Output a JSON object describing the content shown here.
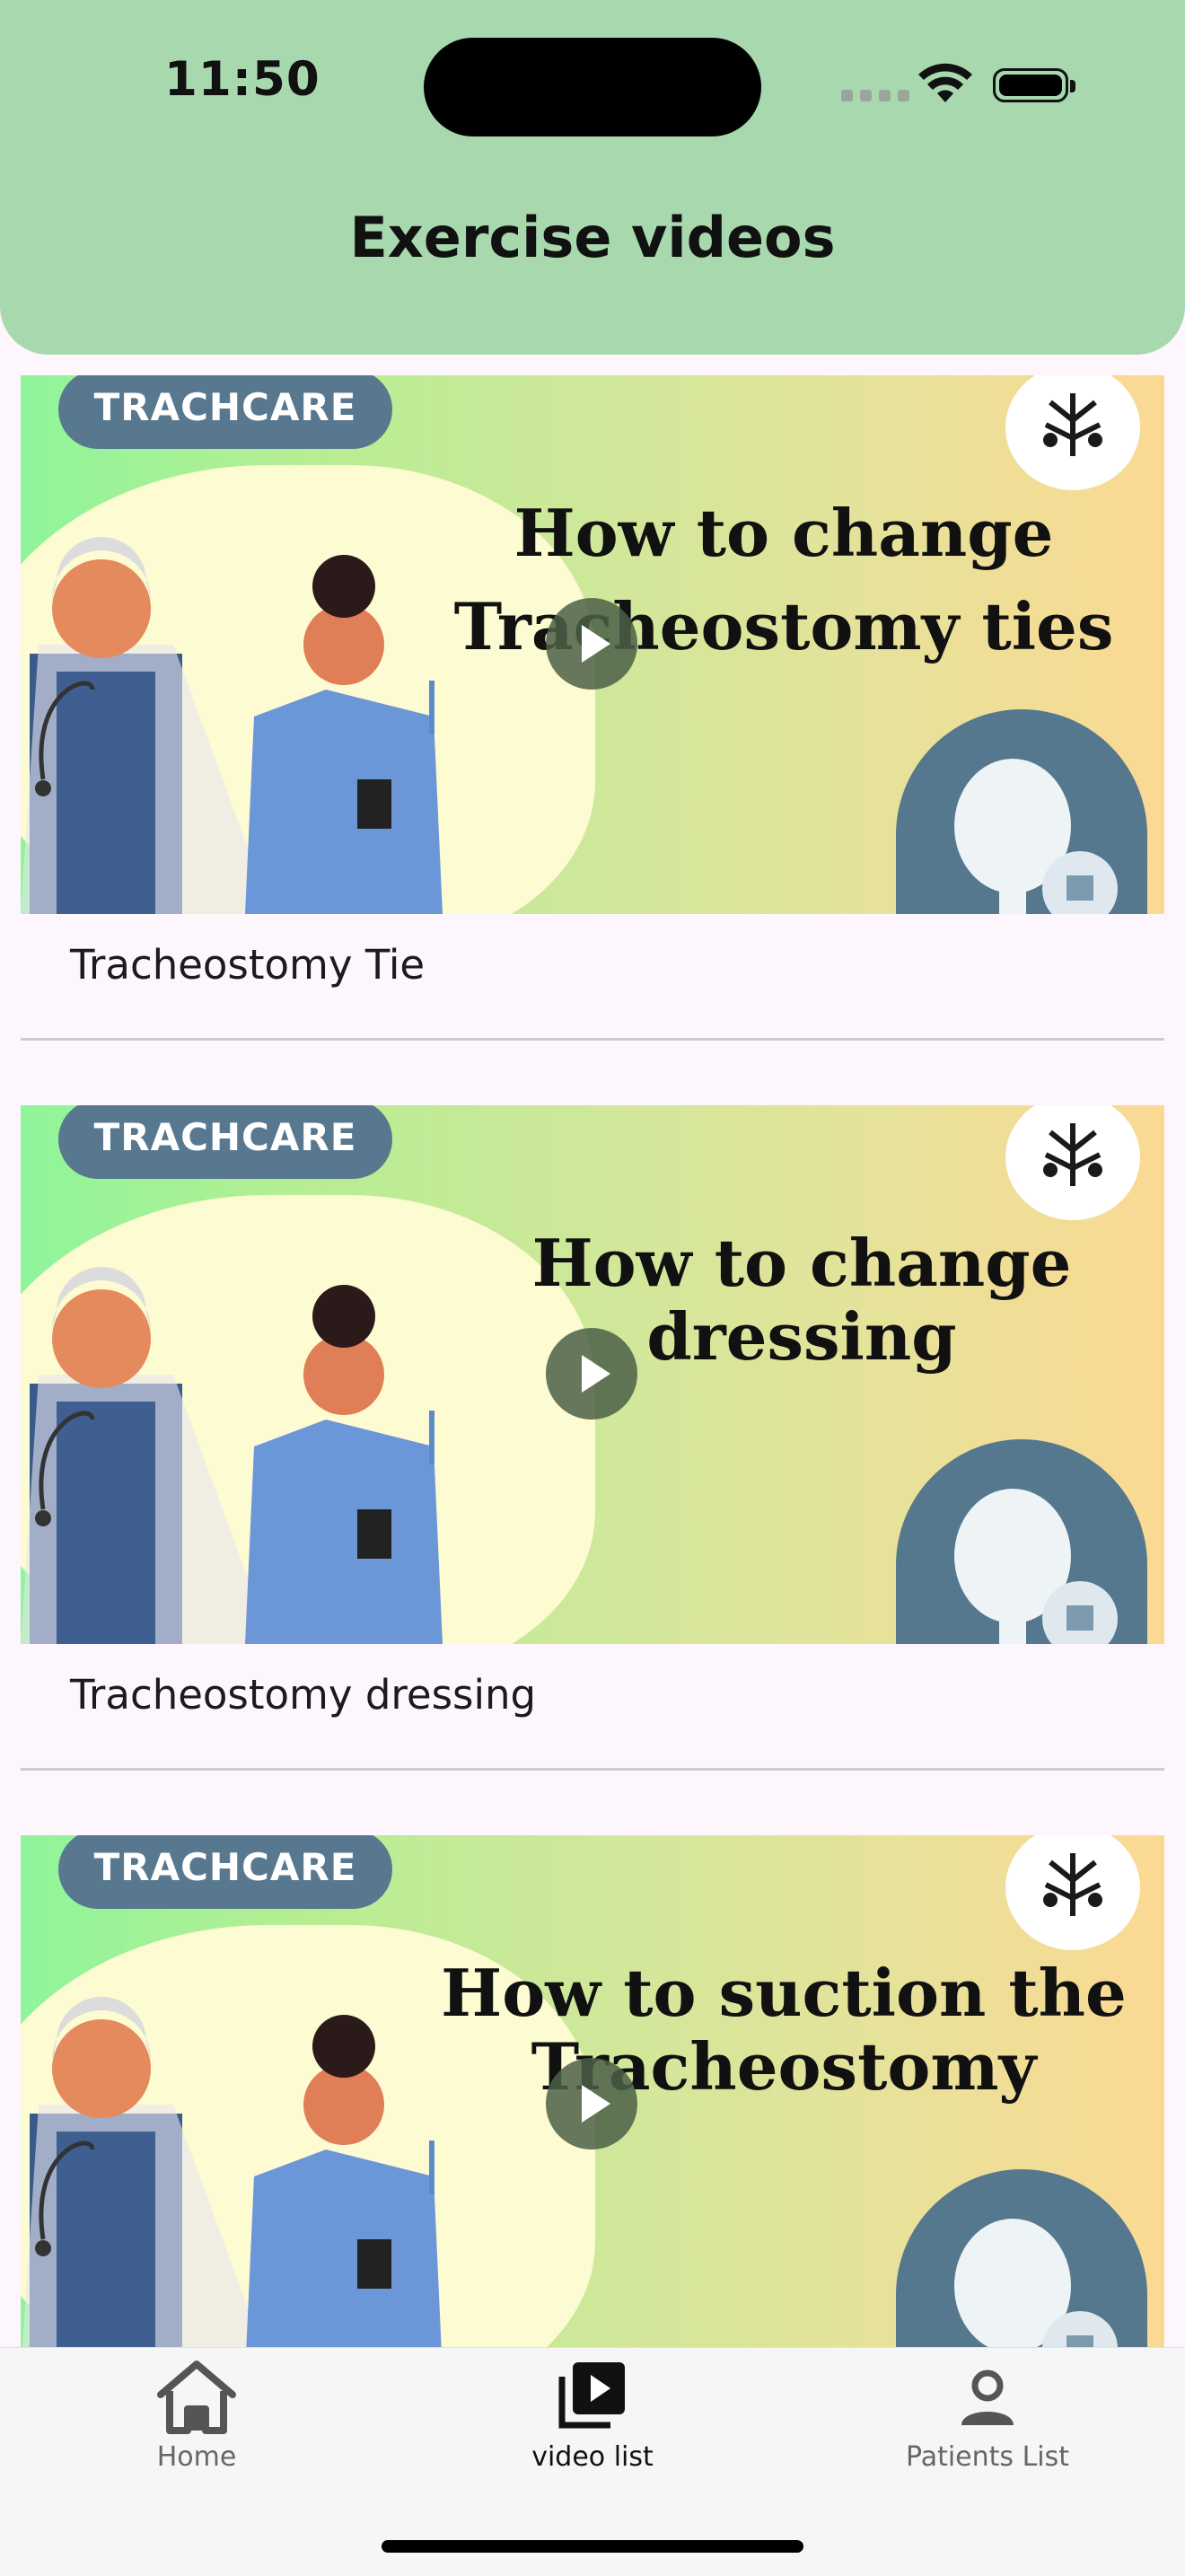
{
  "status_bar": {
    "time": "11:50"
  },
  "header": {
    "title": "Exercise videos"
  },
  "videos": [
    {
      "brand": "TRACHCARE",
      "thumbnail_title": [
        "How to change",
        "Tracheostomy ties"
      ],
      "label": "Tracheostomy Tie"
    },
    {
      "brand": "TRACHCARE",
      "thumbnail_title": [
        "How to change",
        "dressing"
      ],
      "label": "Tracheostomy dressing"
    },
    {
      "brand": "TRACHCARE",
      "thumbnail_title": [
        "How to suction the",
        "Tracheostomy"
      ],
      "label": ""
    }
  ],
  "tabs": [
    {
      "label": "Home",
      "icon": "home-icon",
      "active": false
    },
    {
      "label": "video list",
      "icon": "video-library-icon",
      "active": true
    },
    {
      "label": "Patients List",
      "icon": "person-icon",
      "active": false
    }
  ],
  "colors": {
    "header_bg": "#a8d8ae",
    "page_bg": "#fdf6fd",
    "brand_pill": "#58788f",
    "play_button": "#4b5f46"
  }
}
